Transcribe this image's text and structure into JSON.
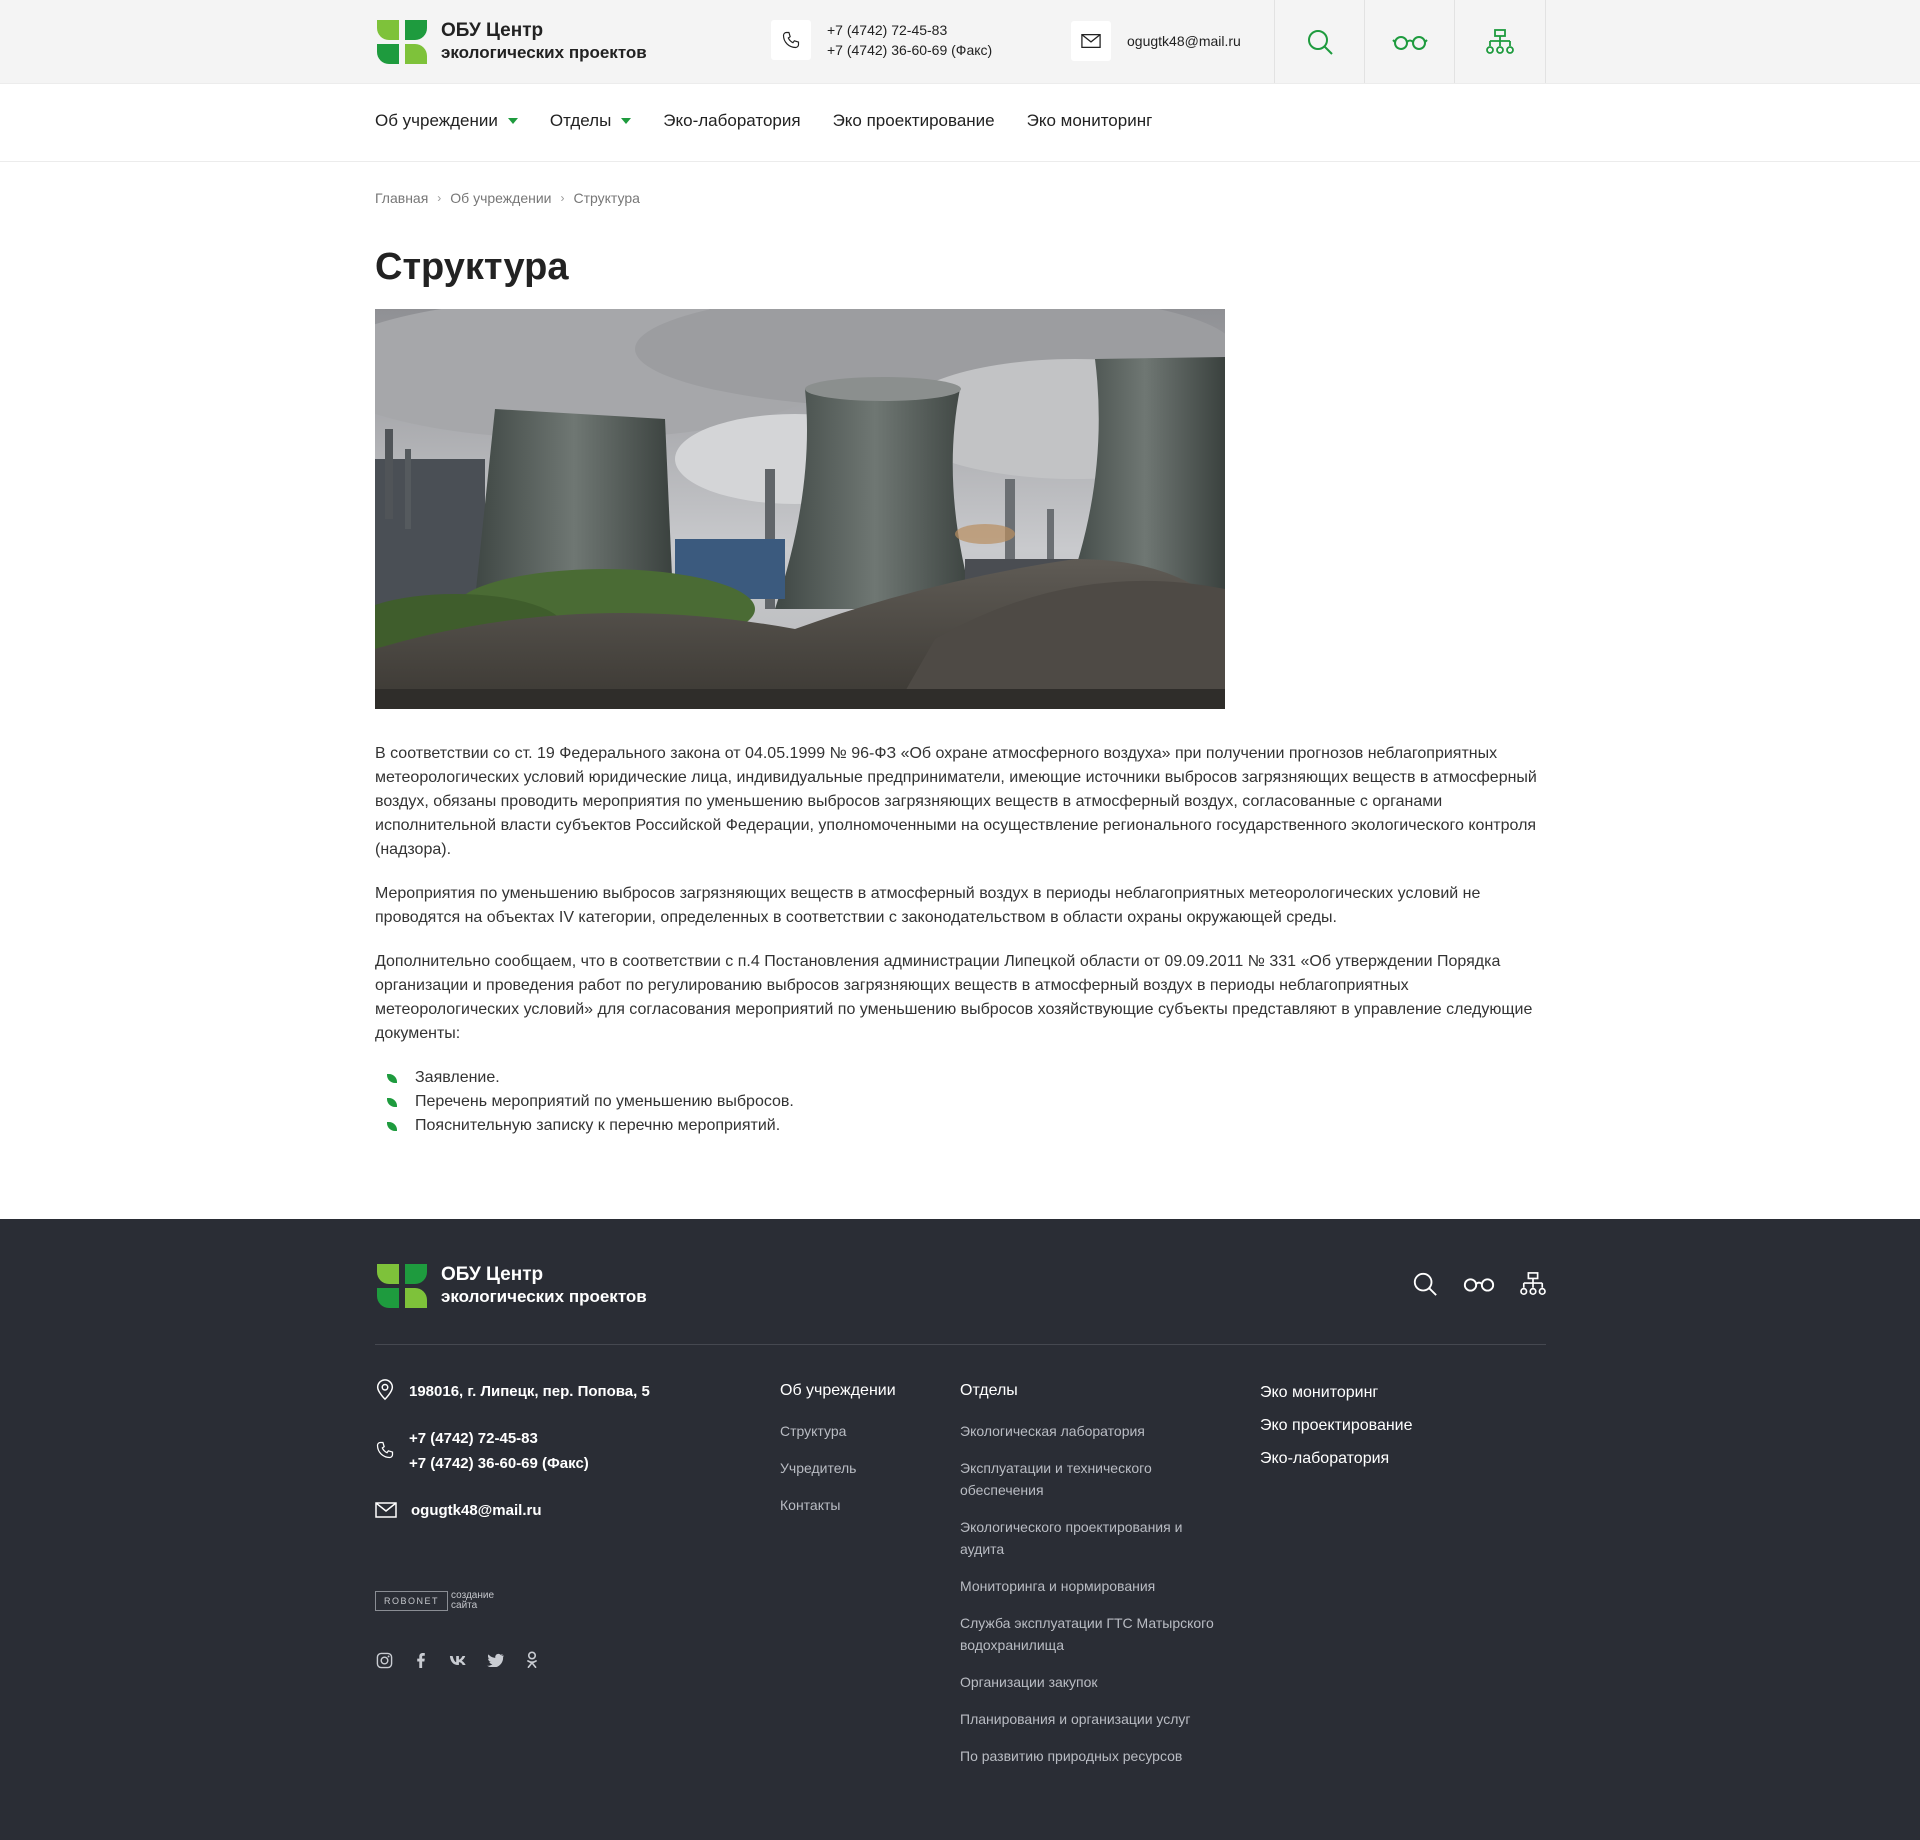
{
  "brand": {
    "name_line1": "ОБУ Центр",
    "name_line2": "экологических проектов",
    "colors": {
      "accent": "#1e9b3e",
      "accent_light": "#7ec23a",
      "footer_bg": "#2a2d35"
    }
  },
  "header": {
    "phone1": "+7 (4742) 72-45-83",
    "phone2": "+7 (4742) 36-60-69 (Факс)",
    "email": "ogugtk48@mail.ru",
    "tools": [
      "search-icon",
      "glasses-icon",
      "sitemap-icon"
    ]
  },
  "nav": [
    {
      "label": "Об учреждении",
      "has_dropdown": true
    },
    {
      "label": "Отделы",
      "has_dropdown": true
    },
    {
      "label": "Эко-лаборатория",
      "has_dropdown": false
    },
    {
      "label": "Эко проектирование",
      "has_dropdown": false
    },
    {
      "label": "Эко мониторинг",
      "has_dropdown": false
    }
  ],
  "breadcrumb": [
    "Главная",
    "Об учреждении",
    "Структура"
  ],
  "page": {
    "title": "Структура",
    "paragraphs": [
      "В соответствии со ст. 19 Федерального закона от 04.05.1999 № 96-ФЗ «Об охране атмосферного воздуха» при получении прогнозов неблагоприятных метеорологических условий юридические лица, индивидуальные предприниматели, имеющие источники выбросов загрязняющих веществ в атмосферный воздух, обязаны проводить мероприятия по уменьшению выбросов загрязняющих веществ в атмосферный воздух, согласованные с органами исполнительной власти субъектов Российской Федерации, уполномоченными на осуществление регионального государственного экологического контроля (надзора).",
      "Мероприятия по уменьшению выбросов загрязняющих веществ в атмосферный воздух в периоды неблагоприятных метеорологических условий не проводятся на объектах IV категории, определенных в соответствии с законодательством в области охраны окружающей среды.",
      "Дополнительно сообщаем, что в соответствии с п.4 Постановления администрации Липецкой области от 09.09.2011 № 331 «Об утверждении Порядка организации и проведения работ по регулированию выбросов загрязняющих веществ в атмосферный воздух в периоды неблагоприятных метеорологических условий» для согласования мероприятий по уменьшению выбросов хозяйствующие субъекты представляют в управление следующие документы:"
    ],
    "list": [
      "Заявление.",
      "Перечень мероприятий по уменьшению выбросов.",
      "Пояснительную записку к перечню мероприятий."
    ]
  },
  "footer": {
    "address": "198016, г. Липецк, пер. Попова, 5",
    "phone1": "+7 (4742) 72-45-83",
    "phone2": "+7 (4742) 36-60-69 (Факс)",
    "email": "ogugtk48@mail.ru",
    "robonet": {
      "badge": "ROBONET",
      "line1": "создание",
      "line2": "сайта"
    },
    "social": [
      "instagram-icon",
      "facebook-icon",
      "vk-icon",
      "twitter-icon",
      "odnoklassniki-icon"
    ],
    "col_about": {
      "head": "Об учреждении",
      "links": [
        "Структура",
        "Учредитель",
        "Контакты"
      ]
    },
    "col_depts": {
      "head": "Отделы",
      "links": [
        "Экологическая лаборатория",
        "Эксплуатации и технического обеспечения",
        "Экологического проектирования и аудита",
        "Мониторинга и нормирования",
        "Служба эксплуатации ГТС Матырского водохранилища",
        "Организации закупок",
        "Планирования и организации услуг",
        "По развитию природных ресурсов"
      ]
    },
    "col_main": [
      "Эко мониторинг",
      "Эко проектирование",
      "Эко-лаборатория"
    ]
  }
}
